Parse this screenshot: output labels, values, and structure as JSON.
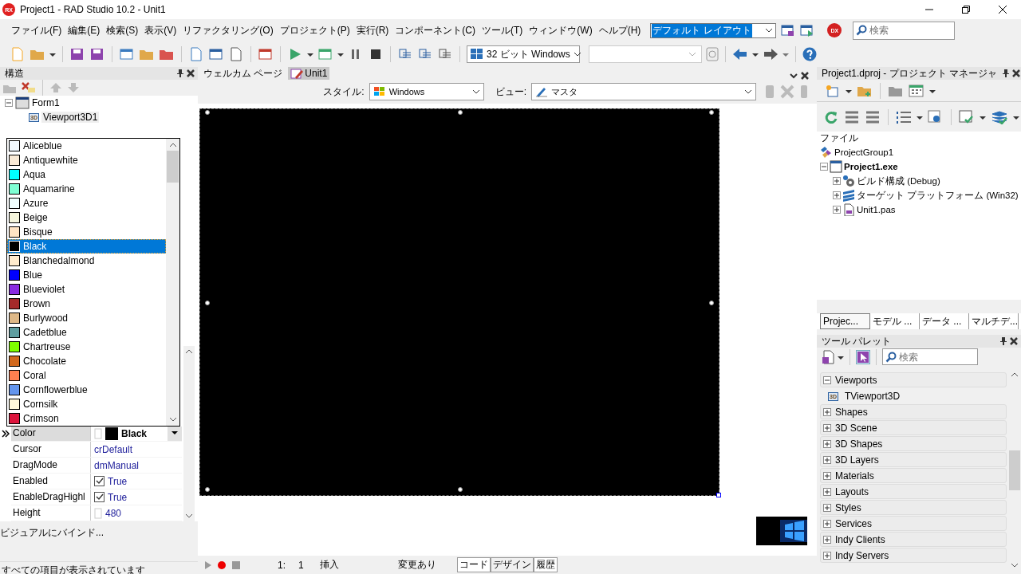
{
  "window": {
    "logo": "RX",
    "title": "Project1 - RAD Studio 10.2 - Unit1"
  },
  "menu": [
    {
      "label": "ファイル(F)"
    },
    {
      "label": "編集(E)"
    },
    {
      "label": "検索(S)"
    },
    {
      "label": "表示(V)"
    },
    {
      "label": "リファクタリング(O)"
    },
    {
      "label": "プロジェクト(P)"
    },
    {
      "label": "実行(R)"
    },
    {
      "label": "コンポーネント(C)"
    },
    {
      "label": "ツール(T)"
    },
    {
      "label": "ウィンドウ(W)"
    },
    {
      "label": "ヘルプ(H)"
    }
  ],
  "layout_combo": {
    "value": "デフォルト レイアウト"
  },
  "dx_badge": "DX",
  "search": {
    "placeholder": "検索"
  },
  "platform_combo": {
    "value": "32 ビット Windows"
  },
  "structure": {
    "title": "構造",
    "tree": [
      {
        "label": "Form1",
        "expanded": true,
        "children": [
          {
            "label": "Viewport3D1",
            "badge": "3D"
          }
        ]
      }
    ]
  },
  "color_list": [
    {
      "name": "Aliceblue",
      "color": "#f0f8ff",
      "selected": false
    },
    {
      "name": "Antiquewhite",
      "color": "#faebd7",
      "selected": false
    },
    {
      "name": "Aqua",
      "color": "#00ffff",
      "selected": false
    },
    {
      "name": "Aquamarine",
      "color": "#7fffd4",
      "selected": false
    },
    {
      "name": "Azure",
      "color": "#f0ffff",
      "selected": false
    },
    {
      "name": "Beige",
      "color": "#f5f5dc",
      "selected": false
    },
    {
      "name": "Bisque",
      "color": "#ffe4c4",
      "selected": false
    },
    {
      "name": "Black",
      "color": "#000000",
      "selected": true
    },
    {
      "name": "Blanchedalmond",
      "color": "#ffebcd",
      "selected": false
    },
    {
      "name": "Blue",
      "color": "#0000ff",
      "selected": false
    },
    {
      "name": "Blueviolet",
      "color": "#8a2be2",
      "selected": false
    },
    {
      "name": "Brown",
      "color": "#a52a2a",
      "selected": false
    },
    {
      "name": "Burlywood",
      "color": "#deb887",
      "selected": false
    },
    {
      "name": "Cadetblue",
      "color": "#5f9ea0",
      "selected": false
    },
    {
      "name": "Chartreuse",
      "color": "#7fff00",
      "selected": false
    },
    {
      "name": "Chocolate",
      "color": "#d2691e",
      "selected": false
    },
    {
      "name": "Coral",
      "color": "#ff7f50",
      "selected": false
    },
    {
      "name": "Cornflowerblue",
      "color": "#6495ed",
      "selected": false
    },
    {
      "name": "Cornsilk",
      "color": "#fff8dc",
      "selected": false
    },
    {
      "name": "Crimson",
      "color": "#dc143c",
      "selected": false
    }
  ],
  "inspector": {
    "rows": [
      {
        "name": "Color",
        "value": "Black",
        "kind": "color",
        "color": "#000000",
        "selected": true
      },
      {
        "name": "Cursor",
        "value": "crDefault",
        "kind": "text",
        "selected": false
      },
      {
        "name": "DragMode",
        "value": "dmManual",
        "kind": "text",
        "selected": false
      },
      {
        "name": "Enabled",
        "value": "True",
        "kind": "bool",
        "checked": true,
        "selected": false
      },
      {
        "name": "EnableDragHighl",
        "value": "True",
        "kind": "bool",
        "checked": true,
        "selected": false
      },
      {
        "name": "Height",
        "value": "480",
        "kind": "number",
        "selected": false
      }
    ],
    "bind_link": "ビジュアルにバインド...",
    "status": "すべての項目が表示されています"
  },
  "editor": {
    "tabs": [
      {
        "label": "ウェルカム ページ",
        "selected": false
      },
      {
        "label": "Unit1",
        "selected": true
      }
    ],
    "style_label": "スタイル:",
    "style_value": "Windows",
    "view_label": "ビュー:",
    "view_value": "マスタ"
  },
  "bottom_bar": {
    "line": "1:",
    "column": "1",
    "mode": "挿入",
    "modified": "変更あり",
    "tabs": [
      {
        "label": "コード",
        "selected": false
      },
      {
        "label": "デザイン",
        "selected": true
      },
      {
        "label": "履歴",
        "selected": false
      }
    ]
  },
  "project_manager": {
    "title": "Project1.dproj - プロジェクト マネージャ",
    "header": "ファイル",
    "root": {
      "label": "ProjectGroup1",
      "children": [
        {
          "label": "Project1.exe",
          "active": true,
          "expanded": true,
          "children": [
            {
              "label": "ビルド構成 (Debug)",
              "kind": "gear",
              "expanded": false
            },
            {
              "label": "ターゲット プラットフォーム (Win32)",
              "kind": "layers",
              "expanded": false
            },
            {
              "label": "Unit1.pas",
              "kind": "file",
              "expanded": false
            }
          ]
        }
      ]
    },
    "tabs": [
      {
        "label": "Projec...",
        "selected": true
      },
      {
        "label": "モデル ...",
        "selected": false
      },
      {
        "label": "データ ...",
        "selected": false
      },
      {
        "label": "マルチデ...",
        "selected": false
      }
    ]
  },
  "palette": {
    "title": "ツール パレット",
    "search_placeholder": "検索",
    "categories": [
      {
        "label": "Viewports",
        "expanded": true,
        "items": [
          {
            "label": "TViewport3D",
            "badge": "3D"
          }
        ]
      },
      {
        "label": "Shapes",
        "expanded": false
      },
      {
        "label": "3D Scene",
        "expanded": false
      },
      {
        "label": "3D Shapes",
        "expanded": false
      },
      {
        "label": "3D Layers",
        "expanded": false
      },
      {
        "label": "Materials",
        "expanded": false
      },
      {
        "label": "Layouts",
        "expanded": false
      },
      {
        "label": "Styles",
        "expanded": false
      },
      {
        "label": "Services",
        "expanded": false
      },
      {
        "label": "Indy Clients",
        "expanded": false
      },
      {
        "label": "Indy Servers",
        "expanded": false
      }
    ]
  }
}
